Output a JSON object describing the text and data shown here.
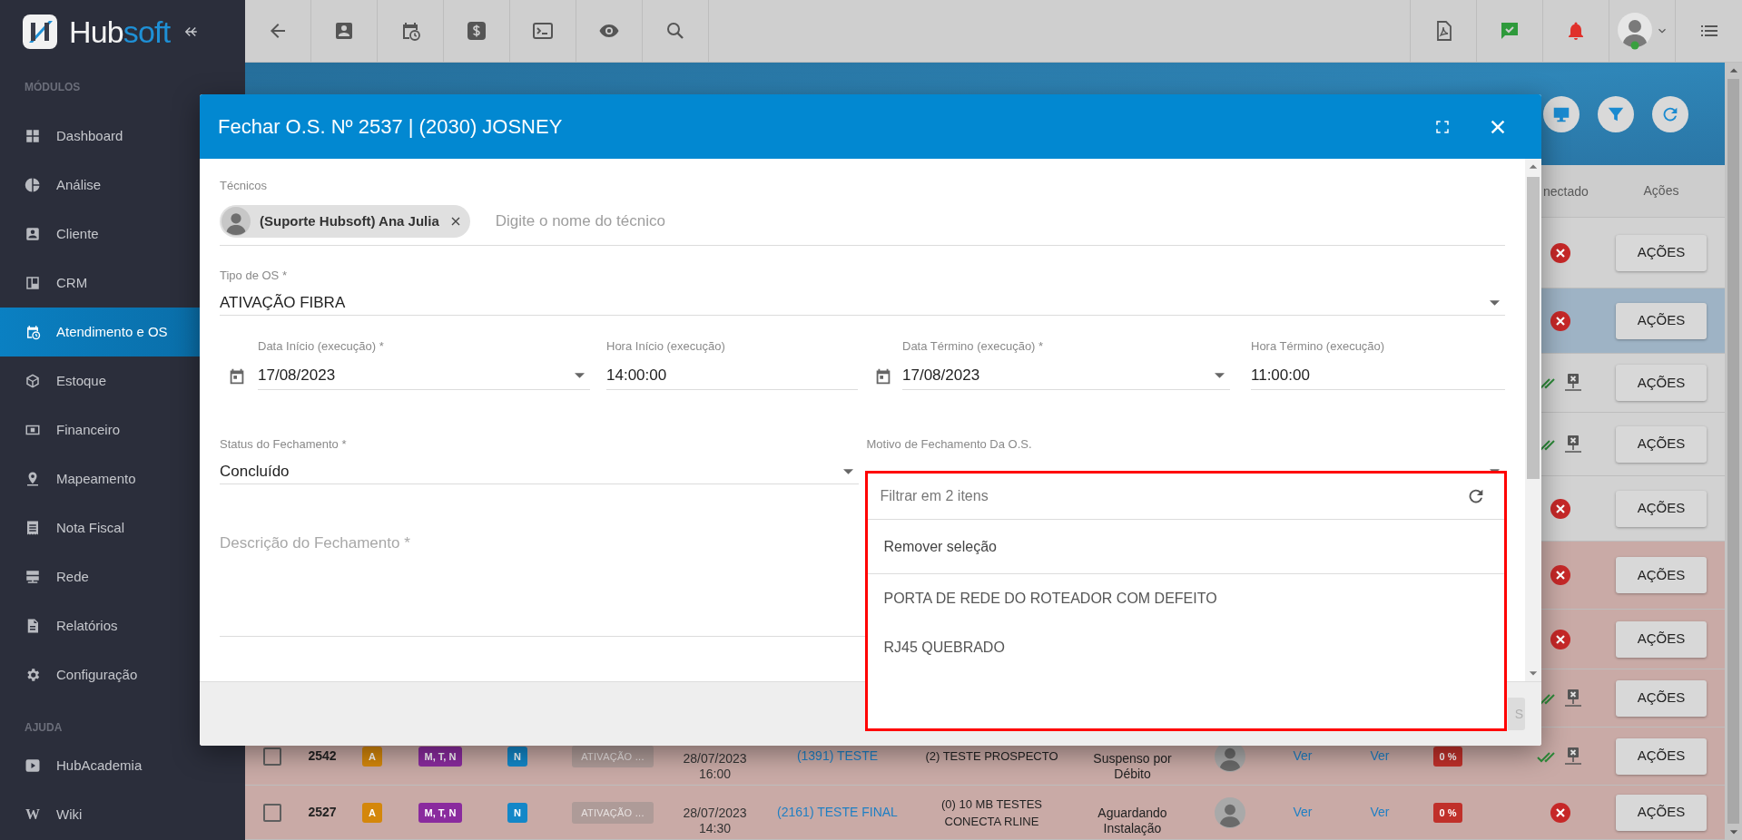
{
  "logo": {
    "parts": [
      "Hub",
      "soft"
    ]
  },
  "sidebar": {
    "sections": [
      {
        "heading": "MÓDULOS",
        "items": [
          {
            "label": "Dashboard",
            "selected": false
          },
          {
            "label": "Análise",
            "selected": false
          },
          {
            "label": "Cliente",
            "selected": false
          },
          {
            "label": "CRM",
            "selected": false
          },
          {
            "label": "Atendimento e OS",
            "selected": true
          },
          {
            "label": "Estoque",
            "selected": false
          },
          {
            "label": "Financeiro",
            "selected": false
          },
          {
            "label": "Mapeamento",
            "selected": false
          },
          {
            "label": "Nota Fiscal",
            "selected": false
          },
          {
            "label": "Rede",
            "selected": false
          },
          {
            "label": "Relatórios",
            "selected": false
          },
          {
            "label": "Configuração",
            "selected": false
          }
        ]
      },
      {
        "heading": "AJUDA",
        "items": [
          {
            "label": "HubAcademia",
            "selected": false
          },
          {
            "label": "Wiki",
            "glyph": "W",
            "selected": false
          }
        ]
      }
    ]
  },
  "table": {
    "columns": [
      {
        "label": "nectado"
      },
      {
        "label": "Ações"
      }
    ],
    "rows": [
      {
        "color": "#d2d2d2",
        "selected": false,
        "connected": false,
        "action": "AÇÕES"
      },
      {
        "color": "#d2d2d2",
        "selected": true,
        "connected": false,
        "action": "AÇÕES"
      },
      {
        "color": "#d2d2d2",
        "selected": false,
        "connected": true,
        "action": "AÇÕES"
      },
      {
        "color": "#d2d2d2",
        "selected": false,
        "connected": true,
        "action": "AÇÕES"
      },
      {
        "color": "#d2d2d2",
        "selected": false,
        "connected": false,
        "action": "AÇÕES"
      },
      {
        "color": "#c9aaa6",
        "selected": false,
        "connected": false,
        "action": "AÇÕES"
      },
      {
        "color": "#c9aaa6",
        "selected": false,
        "connected": false,
        "action": "AÇÕES"
      },
      {
        "color": "#c9aaa6",
        "selected": false,
        "connected": true,
        "action": "AÇÕES"
      },
      {
        "color": "#c9aaa6",
        "selected": false,
        "number": "2542",
        "flags": [
          {
            "text": "A",
            "color": "#d4870b"
          },
          {
            "text": "M, T, N",
            "color": "#8a2b9e"
          },
          {
            "text": "N",
            "color": "#1387c8"
          }
        ],
        "type": "ATIVAÇÃO ...",
        "date": "28/07/2023",
        "time": "16:00",
        "client": "(1391) TESTE",
        "service": "(2) TESTE PROSPECTO",
        "status": "Suspenso por Débito",
        "links": [
          "Ver",
          "Ver"
        ],
        "progress": "0 %",
        "connected": true,
        "action": "AÇÕES"
      },
      {
        "color": "#c9aaa6",
        "selected": false,
        "number": "2527",
        "flags": [
          {
            "text": "A",
            "color": "#d4870b"
          },
          {
            "text": "M, T, N",
            "color": "#8a2b9e"
          },
          {
            "text": "N",
            "color": "#1387c8"
          }
        ],
        "type": "ATIVAÇÃO ...",
        "date": "28/07/2023",
        "time": "14:30",
        "client": "(2161) TESTE FINAL",
        "service": "(0) 10 MB TESTES CONECTA RLINE",
        "status": "Aguardando Instalação",
        "links": [
          "Ver",
          "Ver"
        ],
        "progress": "0 %",
        "connected": false,
        "action": "AÇÕES"
      }
    ]
  },
  "dialog": {
    "title": "Fechar O.S. Nº 2537 | (2030) JOSNEY",
    "technicians": {
      "label": "Técnicos",
      "chips": [
        {
          "label": "(Suporte Hubsoft) Ana Julia"
        }
      ],
      "placeholder": "Digite o nome do técnico"
    },
    "os_type": {
      "label": "Tipo de OS *",
      "value": "ATIVAÇÃO FIBRA"
    },
    "schedule": [
      {
        "kind": "date",
        "label": "Data Início (execução) *",
        "value": "17/08/2023"
      },
      {
        "kind": "time",
        "label": "Hora Início (execução)",
        "value": "14:00:00"
      },
      {
        "kind": "date",
        "label": "Data Término (execução) *",
        "value": "17/08/2023"
      },
      {
        "kind": "time",
        "label": "Hora Término (execução)",
        "value": "11:00:00"
      }
    ],
    "closing": [
      {
        "label": "Status do Fechamento *",
        "value": "Concluído",
        "expanded": false
      },
      {
        "label": "Motivo de Fechamento Da O.S.",
        "expanded": true,
        "dropdown": {
          "placeholder": "Filtrar em 2 itens",
          "clear": "Remover seleção",
          "options": [
            {
              "label": "PORTA DE REDE DO ROTEADOR COM DEFEITO",
              "selected": false
            },
            {
              "label": "RJ45 QUEBRADO",
              "selected": false
            }
          ]
        }
      }
    ],
    "description": {
      "placeholder": "Descrição do Fechamento *"
    },
    "footer_button": "S"
  }
}
